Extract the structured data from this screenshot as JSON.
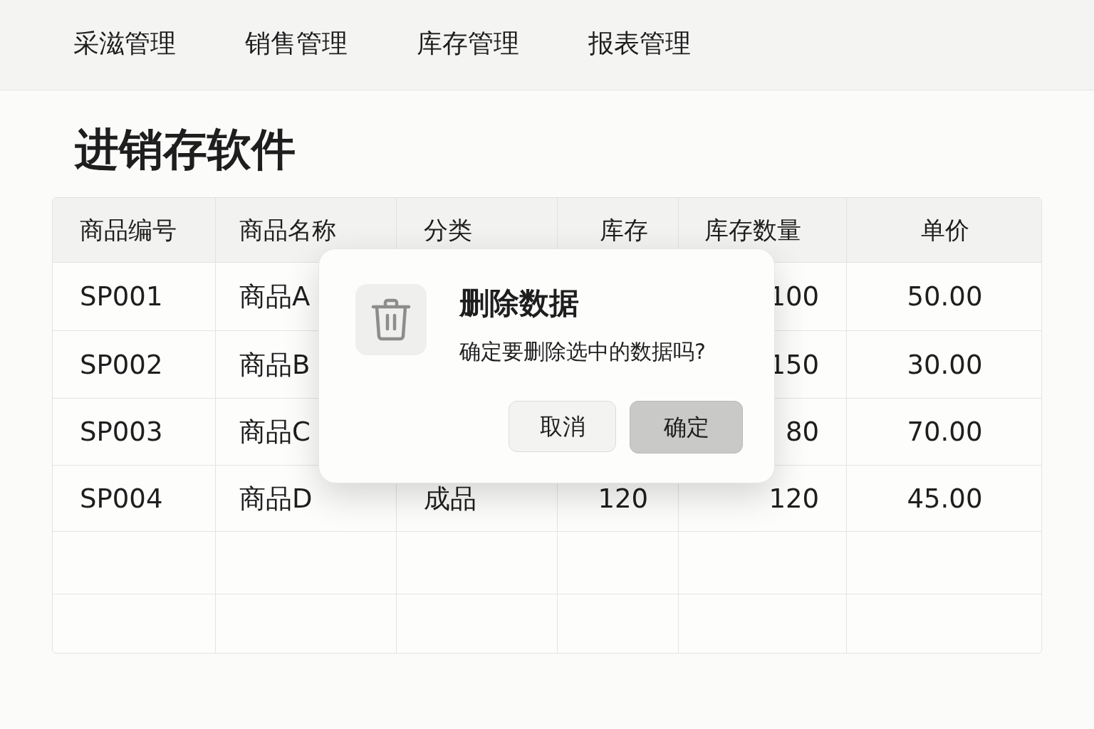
{
  "nav": {
    "tabs": [
      {
        "label": "采滋管理",
        "selected": false
      },
      {
        "label": "销售管理",
        "selected": false
      },
      {
        "label": "库存管理",
        "selected": false
      },
      {
        "label": "报表管理",
        "selected": false
      }
    ]
  },
  "page_title": "进销存软件",
  "table": {
    "columns": [
      "商品编号",
      "商品名称",
      "分类",
      "库存",
      "库存数量",
      "单价"
    ],
    "rows": [
      [
        "SP001",
        "商品A",
        null,
        null,
        "100",
        "50.00"
      ],
      [
        "SP002",
        "商品B",
        null,
        null,
        "150",
        "30.00"
      ],
      [
        "SP003",
        "商品C",
        null,
        null,
        "80",
        "70.00"
      ],
      [
        "SP004",
        "商品D",
        "成品",
        "120",
        "120",
        "45.00"
      ],
      [
        null,
        null,
        null,
        null,
        null,
        null
      ],
      [
        null,
        null,
        null,
        null,
        null,
        null
      ]
    ]
  },
  "dialog": {
    "title": "删除数据",
    "message": "确定要删除选中的数据吗?",
    "buttons": [
      {
        "label": "取消",
        "kind": "secondary"
      },
      {
        "label": "确定",
        "kind": "primary"
      }
    ]
  }
}
